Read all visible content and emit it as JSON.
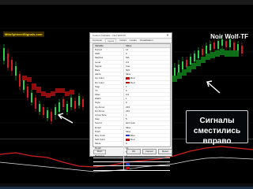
{
  "brand": {
    "logo_text": "MitoSphere4Signals.com",
    "chart_title": "Noir Wolf-TF"
  },
  "dialog": {
    "title": "Custom Indicator - Noir Wolf-TF",
    "tabs": [
      "Common",
      "Inputs",
      "Colors",
      "Levels",
      "Visualization"
    ],
    "active_tab": "Inputs",
    "columns": [
      "Variable",
      "Value"
    ],
    "rows": [
      {
        "name": "Period",
        "value": "14"
      },
      {
        "name": "Shift",
        "value": "0"
      },
      {
        "name": "Method",
        "value": "MA"
      },
      {
        "name": "Level",
        "value": "2.0"
      },
      {
        "name": "Signal",
        "value": "true"
      },
      {
        "name": "Bars",
        "value": "500"
      },
      {
        "name": "Alerts",
        "value": "false"
      },
      {
        "name": "Up Color",
        "value": "Red",
        "swatch": "#cc0000"
      },
      {
        "name": "Dn Color",
        "value": "Red",
        "swatch": "#cc0000"
      },
      {
        "name": "Step",
        "value": "1"
      },
      {
        "name": "TF",
        "value": "0"
      },
      {
        "name": "Filter",
        "value": "0.0"
      },
      {
        "name": "Width",
        "value": "1"
      },
      {
        "name": "Style",
        "value": "0"
      },
      {
        "name": "Up Arrow",
        "value": "233"
      },
      {
        "name": "Dn Arrow",
        "value": "234"
      },
      {
        "name": "Arrow Size",
        "value": "1"
      },
      {
        "name": "Gap",
        "value": "5"
      },
      {
        "name": "Sound",
        "value": "alert.wav"
      },
      {
        "name": "Email",
        "value": "false"
      },
      {
        "name": "Push",
        "value": "false"
      },
      {
        "name": "Buy Color",
        "value": "Blue",
        "swatch": "#1a3bd1"
      },
      {
        "name": "Sell Color",
        "value": "Red",
        "swatch": "#cc0000"
      },
      {
        "name": "Mode",
        "value": "0"
      },
      {
        "name": "Depth",
        "value": "12"
      },
      {
        "name": "Deviation",
        "value": "5"
      },
      {
        "name": "Backstep",
        "value": "3"
      },
      {
        "name": "Show",
        "value": "true"
      },
      {
        "name": "Line",
        "value": "Blue",
        "swatch": "#1a3bd1"
      },
      {
        "name": "Bar Color",
        "value": "Red",
        "swatch": "#cc0000"
      }
    ],
    "reset_label": "Reset",
    "ok_label": "OK",
    "cancel_label": "Cancel",
    "reset_btn_label": "Reset"
  },
  "callout": {
    "line1": "Сигналы",
    "line2": "сместились вправо"
  },
  "colors": {
    "bull": "#2ad24b",
    "bear": "#d21f1f",
    "band": "#9a0f0f",
    "arrow": "#ffffff"
  }
}
